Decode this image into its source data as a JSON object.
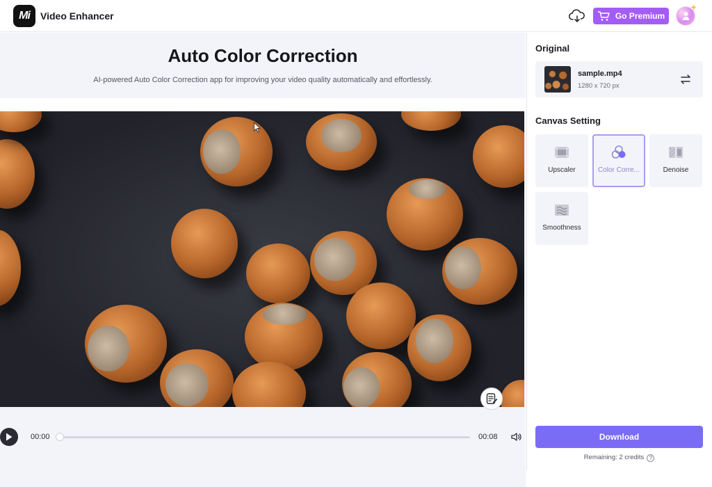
{
  "header": {
    "logo_text": "Mi",
    "app_title": "Video Enhancer",
    "premium_label": "Go Premium",
    "premium_color": "#a35cf6"
  },
  "hero": {
    "title": "Auto Color Correction",
    "subtitle": "AI-powered Auto Color Correction app for improving your video quality automatically and effortlessly."
  },
  "player": {
    "current_time": "00:00",
    "duration": "00:08",
    "progress": 0
  },
  "panel": {
    "original_heading": "Original",
    "file_name": "sample.mp4",
    "file_dimensions": "1280 x 720 px",
    "canvas_heading": "Canvas Setting",
    "tools": [
      {
        "label": "Upscaler",
        "active": false,
        "icon": "upscaler-icon"
      },
      {
        "label": "Color Corre...",
        "active": true,
        "icon": "color-correction-icon"
      },
      {
        "label": "Denoise",
        "active": false,
        "icon": "denoise-icon"
      },
      {
        "label": "Smoothness",
        "active": false,
        "icon": "smoothness-icon"
      }
    ],
    "download_label": "Download",
    "remaining_text": "Remaining: 2 credits",
    "accent_color": "#7b6cf6"
  }
}
